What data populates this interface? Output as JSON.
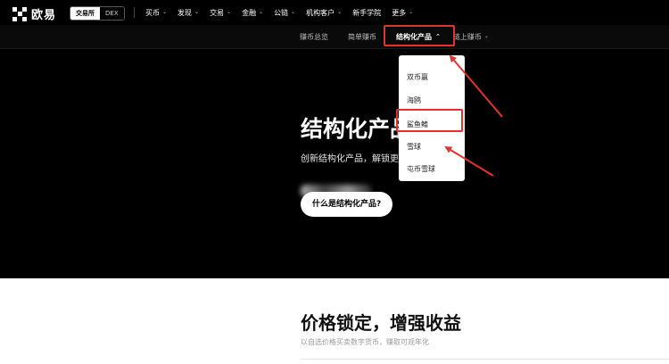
{
  "brand": {
    "name": "欧易",
    "logo_icon": "okx-grid-logo-icon"
  },
  "switcher": {
    "options": [
      "交易所",
      "DEX"
    ],
    "active": "交易所"
  },
  "main_nav": {
    "items": [
      {
        "label": "买币",
        "has_dropdown": true
      },
      {
        "label": "发现",
        "has_dropdown": true
      },
      {
        "label": "交易",
        "has_dropdown": true
      },
      {
        "label": "金融",
        "has_dropdown": true
      },
      {
        "label": "公链",
        "has_dropdown": true
      },
      {
        "label": "机构客户",
        "has_dropdown": true
      },
      {
        "label": "新手学院",
        "has_dropdown": false
      },
      {
        "label": "更多",
        "has_dropdown": true
      }
    ]
  },
  "sub_nav": {
    "items": [
      {
        "label": "赚币总览"
      },
      {
        "label": "简单赚币"
      },
      {
        "label": "结构化产品",
        "active": true,
        "expanded": true
      },
      {
        "label": "链上赚币",
        "has_dropdown": true
      }
    ]
  },
  "dropdown": {
    "items": [
      {
        "label": "双币赢"
      },
      {
        "label": "海鸥"
      },
      {
        "label": "鲨鱼鳍",
        "highlighted": true
      },
      {
        "label": "雪球"
      },
      {
        "label": "屯币雪球"
      }
    ]
  },
  "hero": {
    "title": "结构化产品",
    "subtitle": "创新结构化产品，解锁更",
    "button_label": "什么是结构化产品?"
  },
  "section": {
    "title": "价格锁定，增强收益",
    "subtitle": "以自选价格买卖数字货币，赚取可观年化"
  },
  "colors": {
    "hero_bg": "#000000",
    "annotation_red": "#e0342c",
    "text_white": "#ffffff"
  }
}
